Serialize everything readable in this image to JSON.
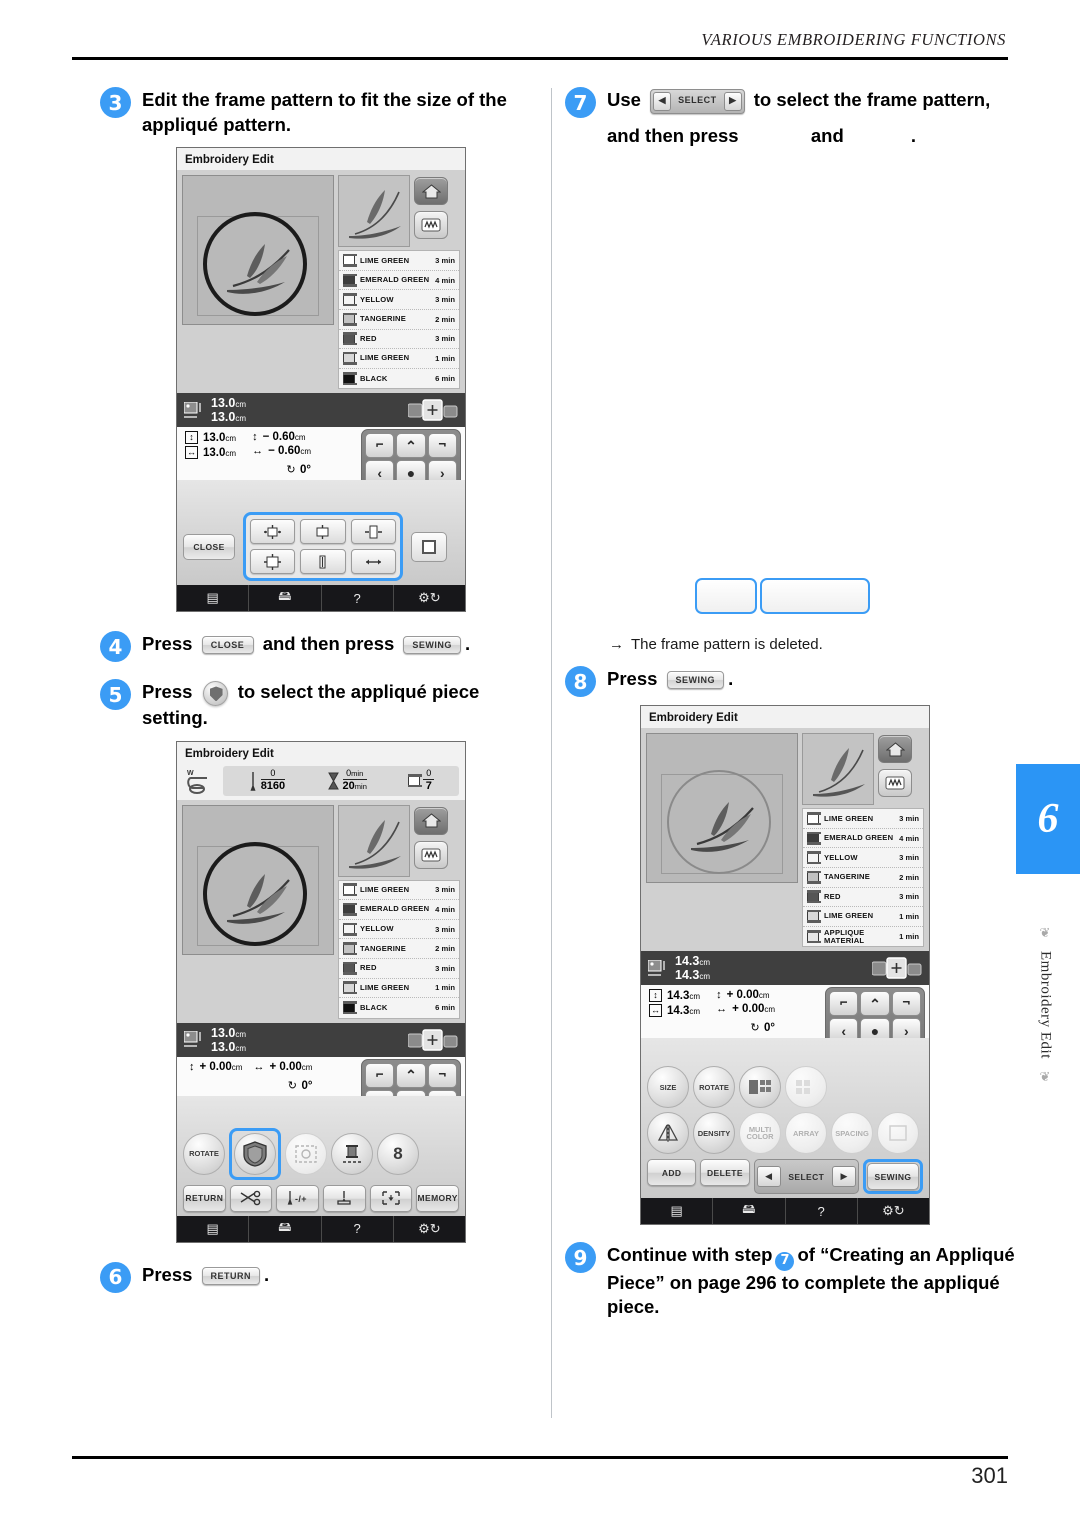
{
  "header": {
    "running_title": "VARIOUS EMBROIDERING FUNCTIONS"
  },
  "footer": {
    "page_number": "301"
  },
  "chapter_tab": {
    "number": "6",
    "label": "Embroidery Edit"
  },
  "steps": {
    "s3": {
      "num": "3",
      "text": "Edit the frame pattern to fit the size of the appliqué pattern."
    },
    "s4": {
      "num": "4",
      "lead": "Press",
      "key1": "CLOSE",
      "mid": "and then press",
      "key2": "SEWING",
      "tail": "."
    },
    "s5": {
      "num": "5",
      "lead": "Press",
      "tail": "to select the appliqué piece setting."
    },
    "s6": {
      "num": "6",
      "lead": "Press",
      "key": "RETURN",
      "tail": "."
    },
    "s7": {
      "num": "7",
      "lead": "Use",
      "select_label": "SELECT",
      "mid": "to select the frame pattern,",
      "line2a": "and then press",
      "line2b": "and",
      "line2c": "."
    },
    "s7_note": {
      "arrow": "→",
      "text": "The frame pattern is deleted."
    },
    "s8": {
      "num": "8",
      "lead": "Press",
      "key": "SEWING",
      "tail": "."
    },
    "s9": {
      "num": "9",
      "t1": "Continue with step",
      "inline_num": "7",
      "t2": "of “Creating an Appliqué Piece” on page 296 to complete the appliqué piece."
    }
  },
  "screen1": {
    "title": "Embroidery Edit",
    "threads": [
      {
        "name": "LIME GREEN",
        "time": "3 min"
      },
      {
        "name": "EMERALD GREEN",
        "time": "4 min"
      },
      {
        "name": "YELLOW",
        "time": "3 min"
      },
      {
        "name": "TANGERINE",
        "time": "2 min"
      },
      {
        "name": "RED",
        "time": "3 min"
      },
      {
        "name": "LIME GREEN",
        "time": "1 min"
      },
      {
        "name": "BLACK",
        "time": "6 min"
      }
    ],
    "size": {
      "w": "13.0",
      "h": "13.0",
      "unit": "cm"
    },
    "dims": {
      "vertical": "13.0",
      "horizontal": "13.0",
      "unit": "cm"
    },
    "offset": {
      "vertical": "− 0.60",
      "horizontal": "− 0.60",
      "unit": "cm",
      "rotation": "0°"
    },
    "close_label": "CLOSE",
    "tabs": [
      "list-icon",
      "machine-icon",
      "?",
      "needle-icon"
    ]
  },
  "screen2": {
    "title": "Embroidery Edit",
    "stats": {
      "stitch_current": "0",
      "stitch_total": "8160",
      "time_current": "0",
      "time_total": "20",
      "time_unit": "min",
      "color_current": "0",
      "color_total": "7"
    },
    "threads": [
      {
        "name": "LIME GREEN",
        "time": "3 min"
      },
      {
        "name": "EMERALD GREEN",
        "time": "4 min"
      },
      {
        "name": "YELLOW",
        "time": "3 min"
      },
      {
        "name": "TANGERINE",
        "time": "2 min"
      },
      {
        "name": "RED",
        "time": "3 min"
      },
      {
        "name": "LIME GREEN",
        "time": "1 min"
      },
      {
        "name": "BLACK",
        "time": "6 min"
      }
    ],
    "size": {
      "w": "13.0",
      "h": "13.0",
      "unit": "cm"
    },
    "offset": {
      "vertical": "+ 0.00",
      "horizontal": "+ 0.00",
      "unit": "cm",
      "rotation": "0°"
    },
    "round_buttons": [
      "ROTATE",
      "applique-icon",
      "border-icon",
      "thread-icon",
      "8"
    ],
    "flat_buttons": [
      "RETURN",
      "cut-icon",
      "needle-plusminus-icon",
      "needle-down-icon",
      "trial-icon",
      "MEMORY"
    ],
    "labels": {
      "rotate": "ROTATE",
      "return": "RETURN",
      "memory": "MEMORY",
      "thread_count": "8"
    }
  },
  "screen3": {
    "title": "Embroidery Edit",
    "threads": [
      {
        "name": "LIME GREEN",
        "time": "3 min"
      },
      {
        "name": "EMERALD GREEN",
        "time": "4 min"
      },
      {
        "name": "YELLOW",
        "time": "3 min"
      },
      {
        "name": "TANGERINE",
        "time": "2 min"
      },
      {
        "name": "RED",
        "time": "3 min"
      },
      {
        "name": "LIME GREEN",
        "time": "1 min"
      },
      {
        "name": "APPLIQUE MATERIAL",
        "time": "1 min"
      }
    ],
    "size": {
      "w": "14.3",
      "h": "14.3",
      "unit": "cm"
    },
    "dims": {
      "vertical": "14.3",
      "horizontal": "14.3",
      "unit": "cm"
    },
    "offset": {
      "vertical": "+ 0.00",
      "horizontal": "+ 0.00",
      "unit": "cm",
      "rotation": "0°"
    },
    "round_row1": [
      "SIZE",
      "ROTATE",
      "border-icon",
      "array-icon"
    ],
    "round_row2": [
      "mirror-icon",
      "DENSITY",
      "MULTI COLOR",
      "ARRAY",
      "SPACING",
      "frame-icon"
    ],
    "labels": {
      "size": "SIZE",
      "rotate": "ROTATE",
      "density": "DENSITY",
      "multi_color": "MULTI COLOR",
      "array": "ARRAY",
      "spacing": "SPACING",
      "add": "ADD",
      "delete": "DELETE",
      "select": "SELECT",
      "sewing": "SEWING"
    }
  },
  "colors": {
    "accent_blue": "#3b9cf5",
    "tab_blue": "#2b95f5",
    "screen_dark": "#3f3f3f"
  }
}
